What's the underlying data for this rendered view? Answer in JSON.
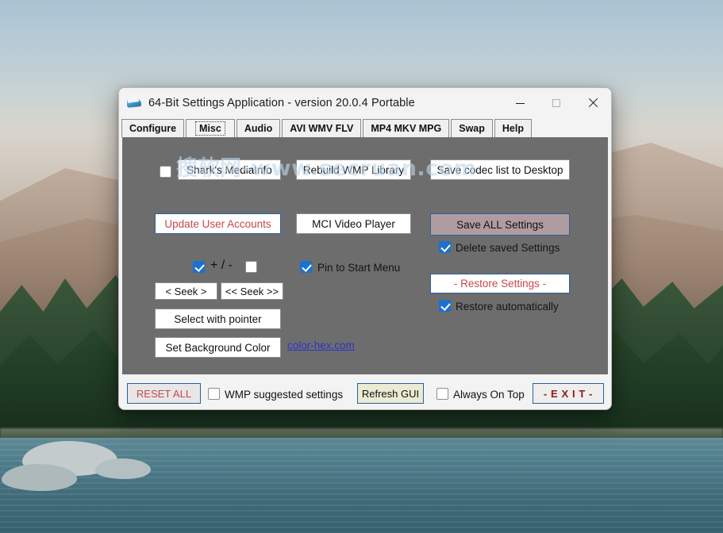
{
  "window": {
    "title": "64-Bit Settings Application - version 20.0.4 Portable",
    "icon": "app-icon",
    "controls": {
      "minimize": "minimize-icon",
      "maximize": "maximize-icon",
      "close": "close-icon"
    }
  },
  "tabs": [
    {
      "label": "Configure",
      "selected": false
    },
    {
      "label": "Misc",
      "selected": true
    },
    {
      "label": "Audio",
      "selected": false
    },
    {
      "label": "AVI WMV FLV",
      "selected": false
    },
    {
      "label": "MP4 MKV MPG",
      "selected": false
    },
    {
      "label": "Swap",
      "selected": false
    },
    {
      "label": "Help",
      "selected": false
    }
  ],
  "panel": {
    "watermark": "搜软网-www.secruan.com",
    "background_color": "#6d6d6d",
    "buttons": {
      "sharks_mediainfo": "Shark's MediaInfo",
      "rebuild_wmp_library": "Rebuild WMP Library",
      "save_codec_list": "Save codec list to Desktop",
      "update_user_accounts": "Update User Accounts",
      "mci_video_player": "MCI Video Player",
      "save_all_settings": "Save ALL Settings",
      "seek_single": "<  Seek  >",
      "seek_double": "<< Seek >>",
      "select_with_pointer": "Select with pointer",
      "set_background_color": "Set Background Color",
      "restore_settings": "- Restore Settings -"
    },
    "checkboxes": {
      "sharks_mediainfo": {
        "checked": false,
        "label": ""
      },
      "plus": {
        "checked": true,
        "label": ""
      },
      "minus": {
        "checked": false,
        "label": ""
      },
      "pin_to_start_menu": {
        "checked": true,
        "label": "Pin to Start Menu"
      },
      "delete_saved_settings": {
        "checked": true,
        "label": "Delete saved Settings"
      },
      "restore_automatically": {
        "checked": true,
        "label": "Restore automatically"
      }
    },
    "plus_minus_label": "+ / -",
    "link": "color-hex.com"
  },
  "bottom_bar": {
    "reset_all": "RESET ALL",
    "wmp_suggested_label": "WMP suggested settings",
    "wmp_suggested_checked": false,
    "refresh_gui": "Refresh GUI",
    "always_on_top_label": "Always On Top",
    "always_on_top_checked": false,
    "exit": "-  E X I T  -"
  },
  "colors": {
    "panel_gray": "#6d6d6d",
    "chrome": "#f3f3f3",
    "accent_blue": "#2c5f9e",
    "red_text": "#c5484b",
    "exit_red": "#8e1b18",
    "link_blue": "#2b34c8",
    "checkbox_blue": "#1a72d0",
    "mauve_button": "#b09ca0",
    "refresh_olive": "#e9ecd2"
  }
}
